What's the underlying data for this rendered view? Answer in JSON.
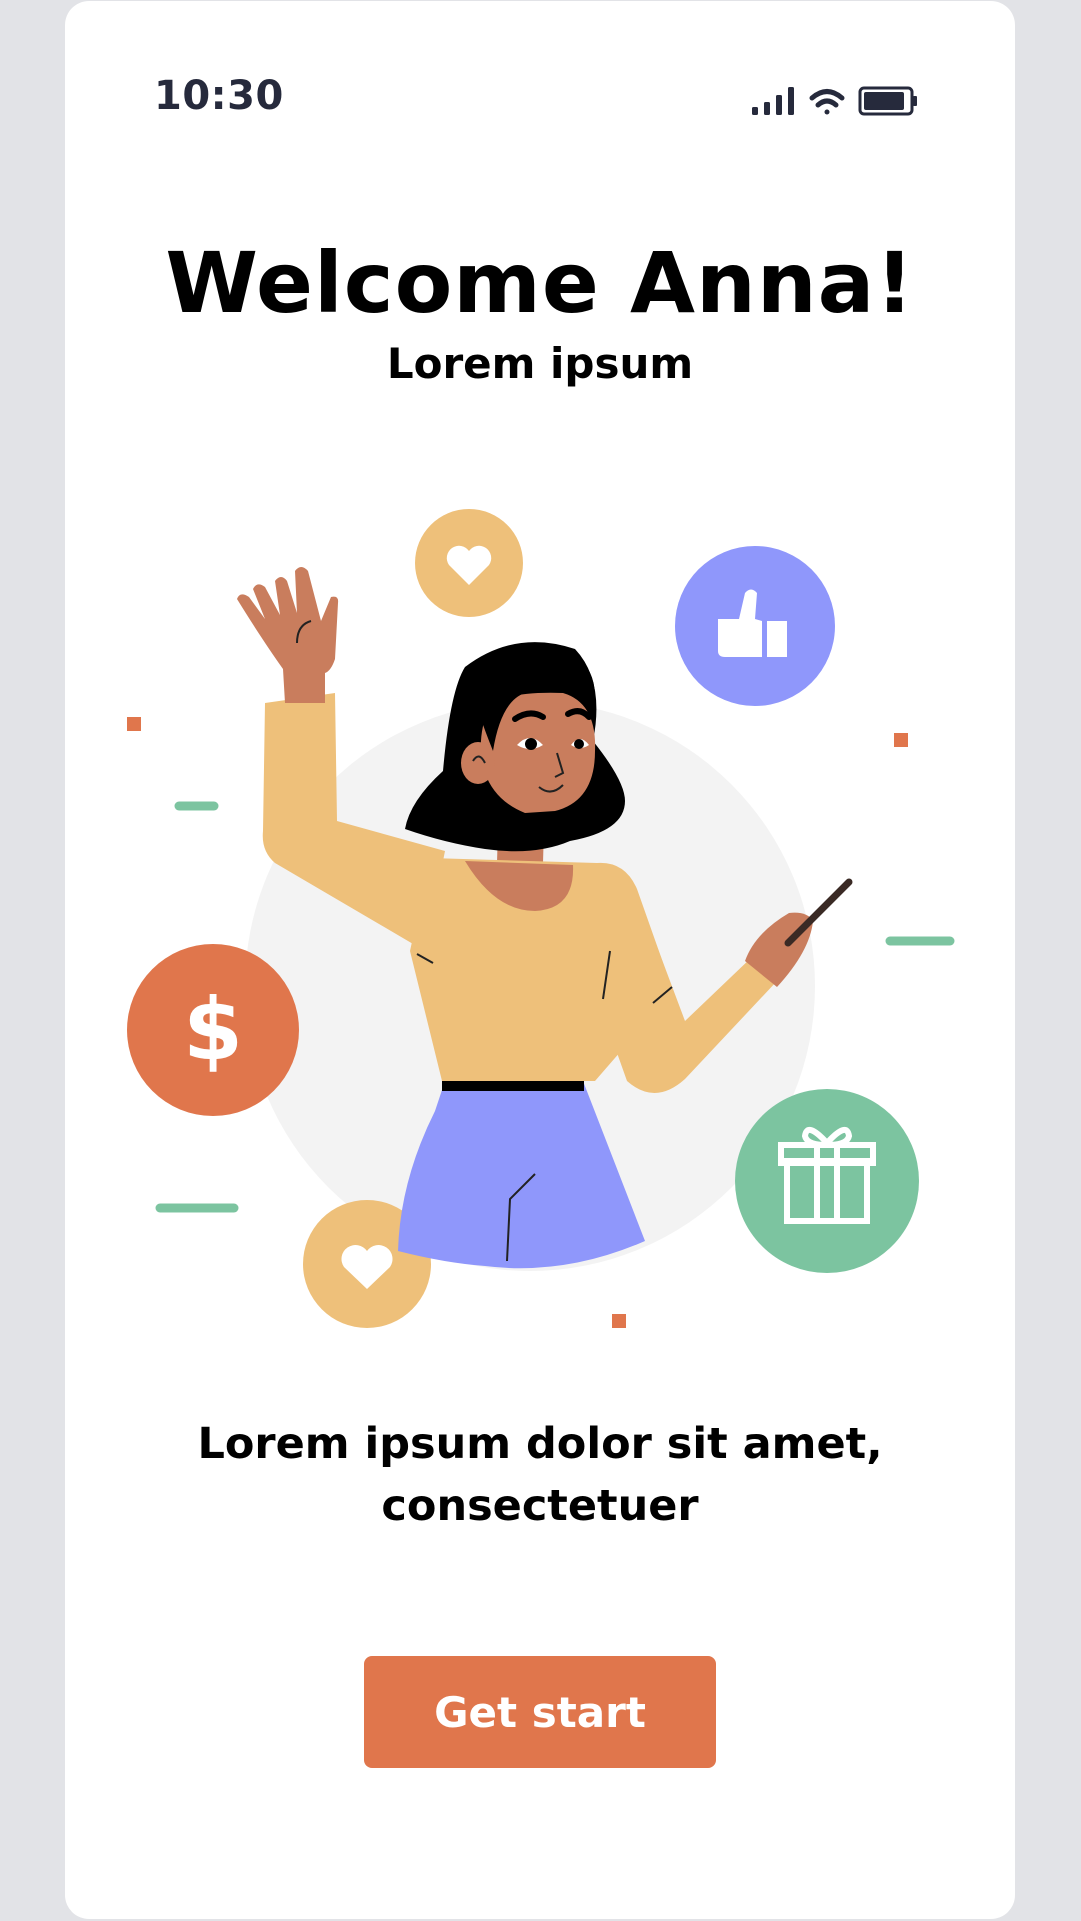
{
  "status_bar": {
    "time": "10:30",
    "icons": [
      "signal-icon",
      "wifi-icon",
      "battery-icon"
    ]
  },
  "welcome": {
    "title": "Welcome Anna!",
    "subtitle": "Lorem ipsum"
  },
  "illustration": {
    "icons": [
      "heart-icon",
      "thumbs-up-icon",
      "dollar-icon",
      "gift-icon",
      "heart-icon"
    ],
    "dollar_glyph": "$"
  },
  "description": {
    "line1": "Lorem ipsum dolor sit amet,",
    "line2": "consectetuer"
  },
  "cta": {
    "label": "Get start"
  },
  "colors": {
    "accent": "#e0764c",
    "yellow": "#eec07a",
    "purple": "#8f97fb",
    "green": "#7cc4a0",
    "skin": "#c97d5d",
    "background": "#e2e3e7"
  }
}
